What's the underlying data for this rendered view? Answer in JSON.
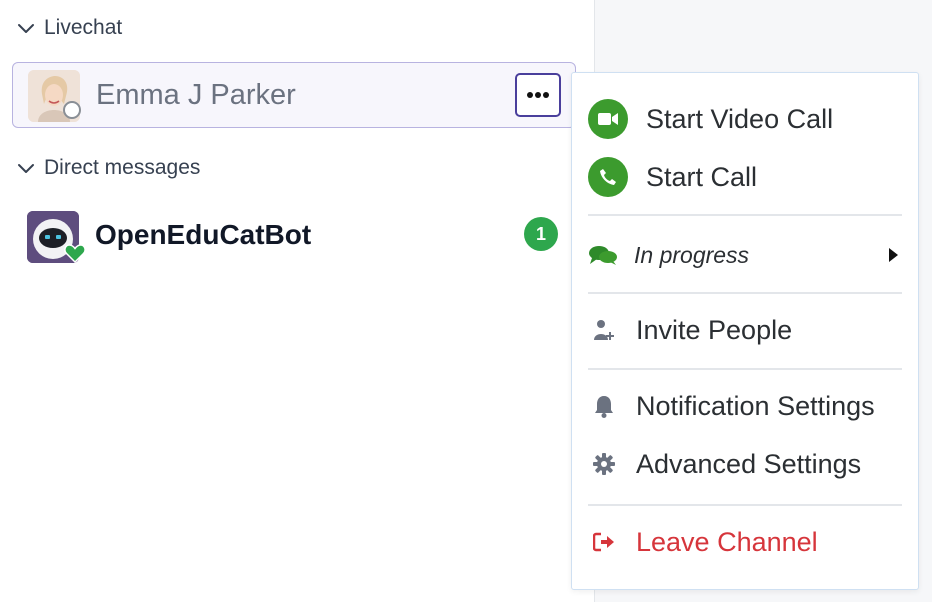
{
  "sidebar": {
    "livechat": {
      "header": "Livechat",
      "channels": [
        {
          "name": "Emma J Parker",
          "status": "offline"
        }
      ]
    },
    "direct_messages": {
      "header": "Direct messages",
      "channels": [
        {
          "name": "OpenEduCatBot",
          "status": "online",
          "unread": "1"
        }
      ]
    }
  },
  "menu": {
    "items": [
      {
        "id": "start_video_call",
        "label": "Start Video Call",
        "icon": "video-camera-icon"
      },
      {
        "id": "start_call",
        "label": "Start Call",
        "icon": "phone-icon"
      },
      {
        "id": "in_progress",
        "label": "In progress",
        "icon": "chat-bubbles-icon"
      },
      {
        "id": "invite_people",
        "label": "Invite People",
        "icon": "user-plus-icon"
      },
      {
        "id": "notification_settings",
        "label": "Notification Settings",
        "icon": "bell-icon"
      },
      {
        "id": "advanced_settings",
        "label": "Advanced Settings",
        "icon": "gear-icon"
      },
      {
        "id": "leave_channel",
        "label": "Leave Channel",
        "icon": "sign-out-icon"
      }
    ]
  },
  "colors": {
    "accent_green": "#3c9b2e",
    "badge_green": "#2ea74d",
    "danger_red": "#d6353b",
    "selected_border": "#b8b3e0",
    "more_button_border": "#4a3f9c"
  }
}
